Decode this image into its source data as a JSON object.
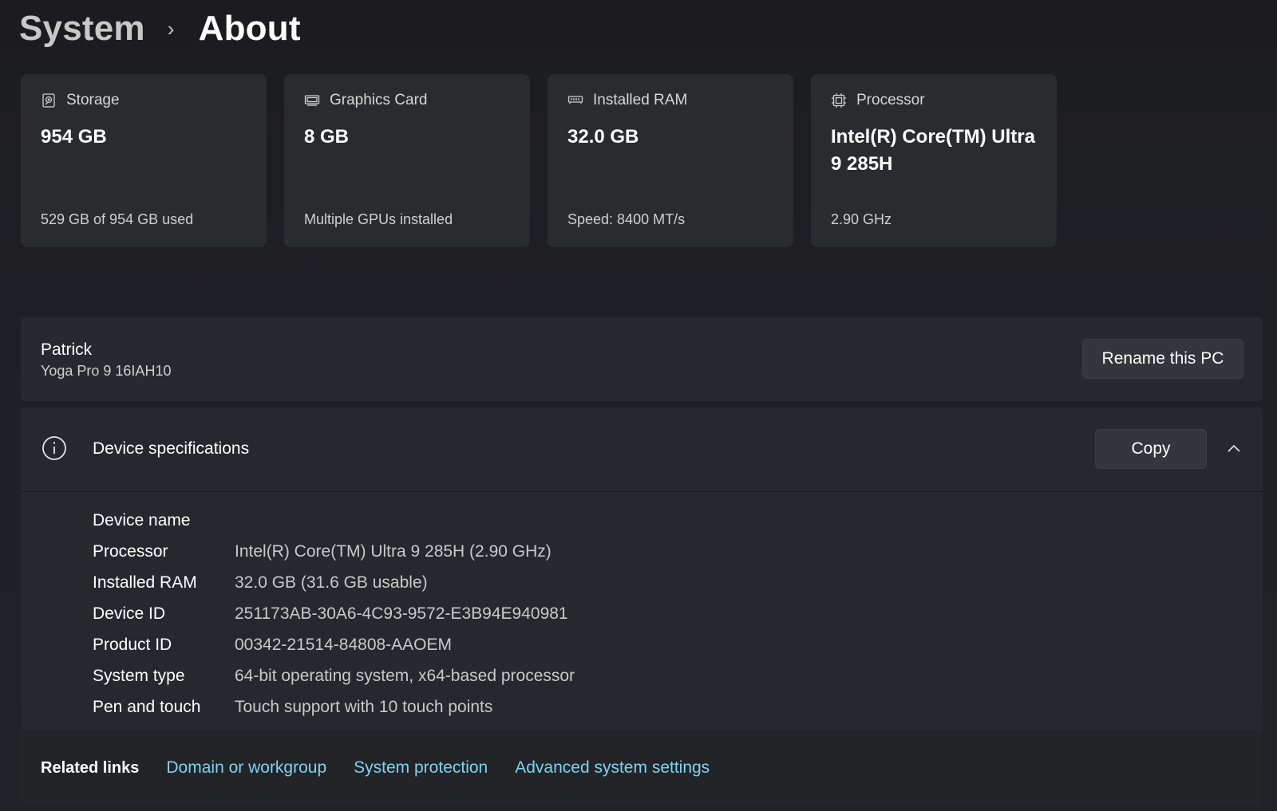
{
  "breadcrumb": {
    "parent": "System",
    "separator": "›",
    "current": "About"
  },
  "cards": [
    {
      "icon": "hard-drive-icon",
      "label": "Storage",
      "value": "954 GB",
      "sub": "529 GB of 954 GB used"
    },
    {
      "icon": "graphics-card-icon",
      "label": "Graphics Card",
      "value": "8 GB",
      "sub": "Multiple GPUs installed"
    },
    {
      "icon": "memory-icon",
      "label": "Installed RAM",
      "value": "32.0 GB",
      "sub": "Speed: 8400 MT/s"
    },
    {
      "icon": "processor-icon",
      "label": "Processor",
      "value": "Intel(R) Core(TM) Ultra 9 285H",
      "sub": "2.90 GHz"
    }
  ],
  "rename": {
    "pc_name": "Patrick",
    "model": "Yoga Pro 9 16IAH10",
    "button_label": "Rename this PC"
  },
  "device_specs": {
    "title": "Device specifications",
    "copy_label": "Copy",
    "rows": [
      {
        "label": "Device name",
        "value": ""
      },
      {
        "label": "Processor",
        "value": "Intel(R) Core(TM) Ultra 9 285H (2.90 GHz)"
      },
      {
        "label": "Installed RAM",
        "value": "32.0 GB (31.6 GB usable)"
      },
      {
        "label": "Device ID",
        "value": "251173AB-30A6-4C93-9572-E3B94E940981"
      },
      {
        "label": "Product ID",
        "value": "00342-21514-84808-AAOEM"
      },
      {
        "label": "System type",
        "value": "64-bit operating system, x64-based processor"
      },
      {
        "label": "Pen and touch",
        "value": "Touch support with 10 touch points"
      }
    ]
  },
  "related_links": {
    "title": "Related links",
    "links": [
      "Domain or workgroup",
      "System protection",
      "Advanced system settings"
    ]
  },
  "colors": {
    "link": "#7fd3f0",
    "card_bg": "#2a2b2f",
    "panel_bg": "#27292e"
  }
}
